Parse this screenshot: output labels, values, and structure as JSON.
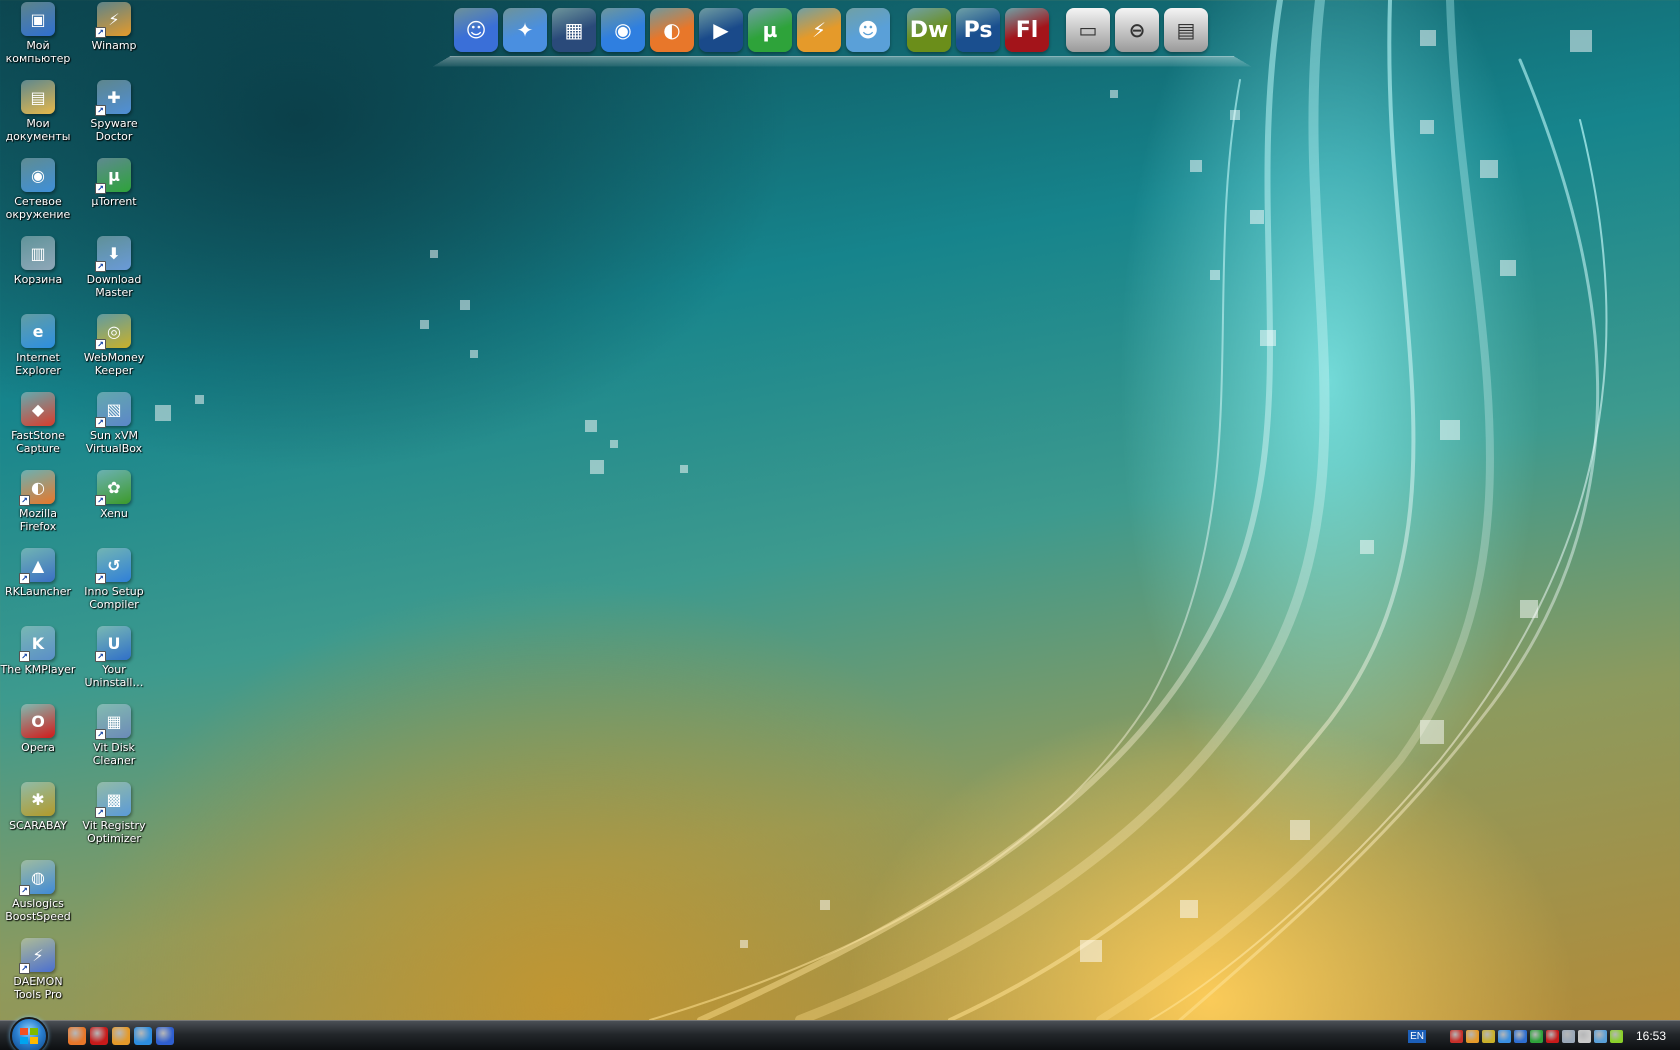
{
  "desktop": {
    "icons_col1": [
      {
        "label": "Мой компьютер",
        "icon": "my-computer-icon",
        "color": "#2f6fd0",
        "glyph": "▣",
        "shortcut": false
      },
      {
        "label": "Мои документы",
        "icon": "my-documents-icon",
        "color": "#e7b84a",
        "glyph": "▤",
        "shortcut": false
      },
      {
        "label": "Сетевое окружение",
        "icon": "network-icon",
        "color": "#3f8fd8",
        "glyph": "◉",
        "shortcut": false
      },
      {
        "label": "Корзина",
        "icon": "recycle-bin-icon",
        "color": "#8fa7b8",
        "glyph": "▥",
        "shortcut": false
      },
      {
        "label": "Internet Explorer",
        "icon": "internet-explorer-icon",
        "color": "#2d8ee0",
        "glyph": "e",
        "shortcut": false
      },
      {
        "label": "FastStone Capture",
        "icon": "faststone-capture-icon",
        "color": "#d83c2c",
        "glyph": "◆",
        "shortcut": false
      },
      {
        "label": "Mozilla Firefox",
        "icon": "firefox-icon",
        "color": "#e8772a",
        "glyph": "◐",
        "shortcut": true
      },
      {
        "label": "RKLauncher",
        "icon": "rklauncher-icon",
        "color": "#3a6fc4",
        "glyph": "▲",
        "shortcut": true
      },
      {
        "label": "The KMPlayer",
        "icon": "kmplayer-icon",
        "color": "#5a8ec8",
        "glyph": "K",
        "shortcut": true
      },
      {
        "label": "Opera",
        "icon": "opera-icon",
        "color": "#d11a1a",
        "glyph": "O",
        "shortcut": false
      },
      {
        "label": "SCARABAY",
        "icon": "scarabay-icon",
        "color": "#b19a2a",
        "glyph": "✱",
        "shortcut": false
      },
      {
        "label": "Auslogics BoostSpeed",
        "icon": "auslogics-icon",
        "color": "#3f8ad8",
        "glyph": "◍",
        "shortcut": true
      },
      {
        "label": "DAEMON Tools Pro",
        "icon": "daemon-tools-icon",
        "color": "#4a6fd0",
        "glyph": "⚡",
        "shortcut": true
      }
    ],
    "icons_col2": [
      {
        "label": "Winamp",
        "icon": "winamp-icon",
        "color": "#e59a2a",
        "glyph": "⚡",
        "shortcut": true
      },
      {
        "label": "Spyware Doctor",
        "icon": "spyware-doctor-icon",
        "color": "#4f8fd8",
        "glyph": "✚",
        "shortcut": true
      },
      {
        "label": "µTorrent",
        "icon": "utorrent-icon",
        "color": "#2ea33a",
        "glyph": "µ",
        "shortcut": true
      },
      {
        "label": "Download Master",
        "icon": "download-master-icon",
        "color": "#6a9ad8",
        "glyph": "⬇",
        "shortcut": true
      },
      {
        "label": "WebMoney Keeper Clas…",
        "icon": "webmoney-icon",
        "color": "#c9b02a",
        "glyph": "◎",
        "shortcut": true
      },
      {
        "label": "Sun xVM VirtualBox",
        "icon": "virtualbox-icon",
        "color": "#5b86c8",
        "glyph": "▧",
        "shortcut": true
      },
      {
        "label": "Xenu",
        "icon": "xenu-icon",
        "color": "#3c9a2a",
        "glyph": "✿",
        "shortcut": true
      },
      {
        "label": "Inno Setup Compiler",
        "icon": "inno-setup-icon",
        "color": "#2f7fd8",
        "glyph": "↺",
        "shortcut": true
      },
      {
        "label": "Your Uninstall…",
        "icon": "your-uninstaller-icon",
        "color": "#2f6fc8",
        "glyph": "U",
        "shortcut": true
      },
      {
        "label": "Vit Disk Cleaner",
        "icon": "vit-disk-cleaner-icon",
        "color": "#6a8ab8",
        "glyph": "▦",
        "shortcut": true
      },
      {
        "label": "Vit Registry Optimizer",
        "icon": "vit-registry-optimizer-icon",
        "color": "#5a9ad8",
        "glyph": "▩",
        "shortcut": true
      }
    ]
  },
  "dock": {
    "items": [
      {
        "name": "finder-icon",
        "color": "#3a6fd8",
        "glyph": "☺"
      },
      {
        "name": "safari-icon",
        "color": "#4a8fe0",
        "glyph": "✦"
      },
      {
        "name": "dashboard-icon",
        "color": "#2a4a7a",
        "glyph": "▦"
      },
      {
        "name": "internet-globe-icon",
        "color": "#2f7fe0",
        "glyph": "◉"
      },
      {
        "name": "firefox-dock-icon",
        "color": "#e8772a",
        "glyph": "◐"
      },
      {
        "name": "media-player-icon",
        "color": "#1a4a8a",
        "glyph": "▶"
      },
      {
        "name": "utorrent-dock-icon",
        "color": "#2ea33a",
        "glyph": "µ"
      },
      {
        "name": "winamp-dock-icon",
        "color": "#e59a2a",
        "glyph": "⚡"
      },
      {
        "name": "messenger-icon",
        "color": "#5aa0d8",
        "glyph": "☻"
      },
      {
        "name": "gap",
        "color": "",
        "glyph": ""
      },
      {
        "name": "dreamweaver-icon",
        "color": "#6b8e1a",
        "glyph": "Dw"
      },
      {
        "name": "photoshop-icon",
        "color": "#1a4f8f",
        "glyph": "Ps"
      },
      {
        "name": "flash-icon",
        "color": "#a3141a",
        "glyph": "Fl"
      },
      {
        "name": "gap",
        "color": "",
        "glyph": ""
      },
      {
        "name": "drive-icon",
        "color": "#d8d8d8",
        "glyph": "▭"
      },
      {
        "name": "drive-eject-icon",
        "color": "#d8d8d8",
        "glyph": "⊖"
      },
      {
        "name": "disk-icon",
        "color": "#d8d8d8",
        "glyph": "▤"
      }
    ]
  },
  "taskbar": {
    "quicklaunch": [
      {
        "name": "ql-firefox-icon",
        "color": "#e8772a"
      },
      {
        "name": "ql-opera-icon",
        "color": "#c81a1a"
      },
      {
        "name": "ql-winamp-icon",
        "color": "#e59a2a"
      },
      {
        "name": "ql-ie-icon",
        "color": "#2d8ee0"
      },
      {
        "name": "ql-show-desktop-icon",
        "color": "#2f5fd0"
      }
    ],
    "language": "EN",
    "tray_icons": [
      {
        "name": "tray-app1-icon",
        "color": "#c8302a"
      },
      {
        "name": "tray-winamp-icon",
        "color": "#e59a2a"
      },
      {
        "name": "tray-webmoney-icon",
        "color": "#c9b02a"
      },
      {
        "name": "tray-network-icon",
        "color": "#3a8fe0"
      },
      {
        "name": "tray-display-icon",
        "color": "#2f6fd0"
      },
      {
        "name": "tray-utorrent-icon",
        "color": "#2ea33a"
      },
      {
        "name": "tray-opera-icon",
        "color": "#c81a1a"
      },
      {
        "name": "tray-safely-remove-icon",
        "color": "#9aa8b8"
      },
      {
        "name": "tray-volume-icon",
        "color": "#c9c9c9"
      },
      {
        "name": "tray-messenger-icon",
        "color": "#5aa0d8"
      },
      {
        "name": "tray-battery-icon",
        "color": "#8ad02a"
      }
    ],
    "clock": "16:53"
  }
}
